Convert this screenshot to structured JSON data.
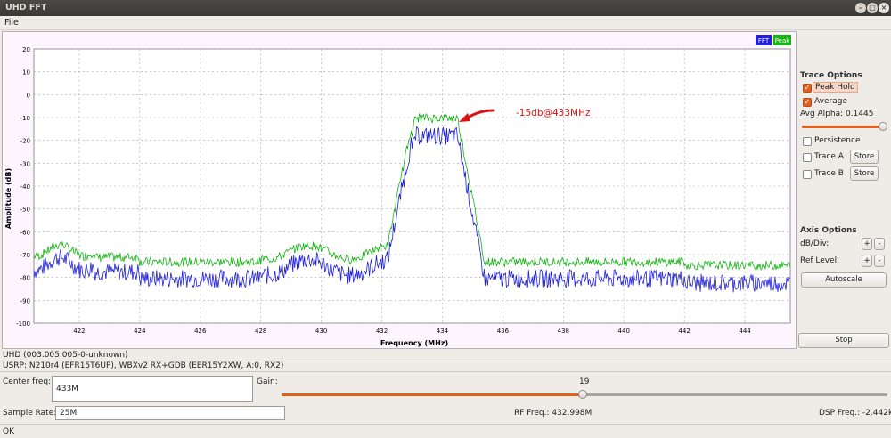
{
  "window": {
    "title": "UHD FFT"
  },
  "menu": {
    "file": "File"
  },
  "legend": {
    "fft": "FFT",
    "peak": "Peak"
  },
  "colors": {
    "fft": "#2020d8",
    "peak": "#13b313",
    "annotation": "#dd1111",
    "accent": "#e0601e"
  },
  "chart_data": {
    "type": "line",
    "xlabel": "Frequency (MHz)",
    "ylabel": "Amplitude (dB)",
    "xlim": [
      420.5,
      445.5
    ],
    "ylim": [
      -100,
      20
    ],
    "x_ticks": [
      422,
      424,
      426,
      428,
      430,
      432,
      434,
      436,
      438,
      440,
      442,
      444
    ],
    "y_ticks": [
      20,
      10,
      0,
      -10,
      -20,
      -30,
      -40,
      -50,
      -60,
      -70,
      -80,
      -90,
      -100
    ],
    "grid": true,
    "legend_position": "top-right",
    "annotation": {
      "text": "-15db@433MHz",
      "x": 434.3,
      "y": -10
    },
    "series": [
      {
        "name": "FFT",
        "baseline": -80.5,
        "peak_center": 433.8,
        "peak_level": -18
      },
      {
        "name": "Peak",
        "baseline": -74,
        "peak_center": 433.8,
        "peak_level": -11
      }
    ]
  },
  "trace_options": {
    "title": "Trace Options",
    "peak_hold": {
      "label": "Peak Hold",
      "checked": true
    },
    "average": {
      "label": "Average",
      "checked": true
    },
    "avg_alpha_label": "Avg Alpha: 0.1445",
    "avg_alpha_value": 0.1445,
    "persistence": {
      "label": "Persistence",
      "checked": false
    },
    "trace_a": {
      "label": "Trace A",
      "checked": false,
      "store": "Store"
    },
    "trace_b": {
      "label": "Trace B",
      "checked": false,
      "store": "Store"
    }
  },
  "axis_options": {
    "title": "Axis Options",
    "db_div": "dB/Div:",
    "ref_level": "Ref Level:",
    "plus": "+",
    "minus": "-",
    "autoscale": "Autoscale"
  },
  "stop": "Stop",
  "info": {
    "uhd": "UHD (003.005.005-0-unknown)",
    "usrp": "USRP: N210r4 (EFR15T6UP), WBXv2 RX+GDB (EER15Y2XW, A:0, RX2)"
  },
  "controls": {
    "center_freq_label": "Center freq:",
    "center_freq_value": "433M",
    "gain_label": "Gain:",
    "gain_value": "19",
    "gain_fraction": 0.595,
    "sample_rate_label": "Sample Rate:",
    "sample_rate_value": "25M",
    "rf_freq": "RF Freq.: 432.998M",
    "dsp_freq": "DSP Freq.: -2.442k"
  },
  "status": "OK"
}
